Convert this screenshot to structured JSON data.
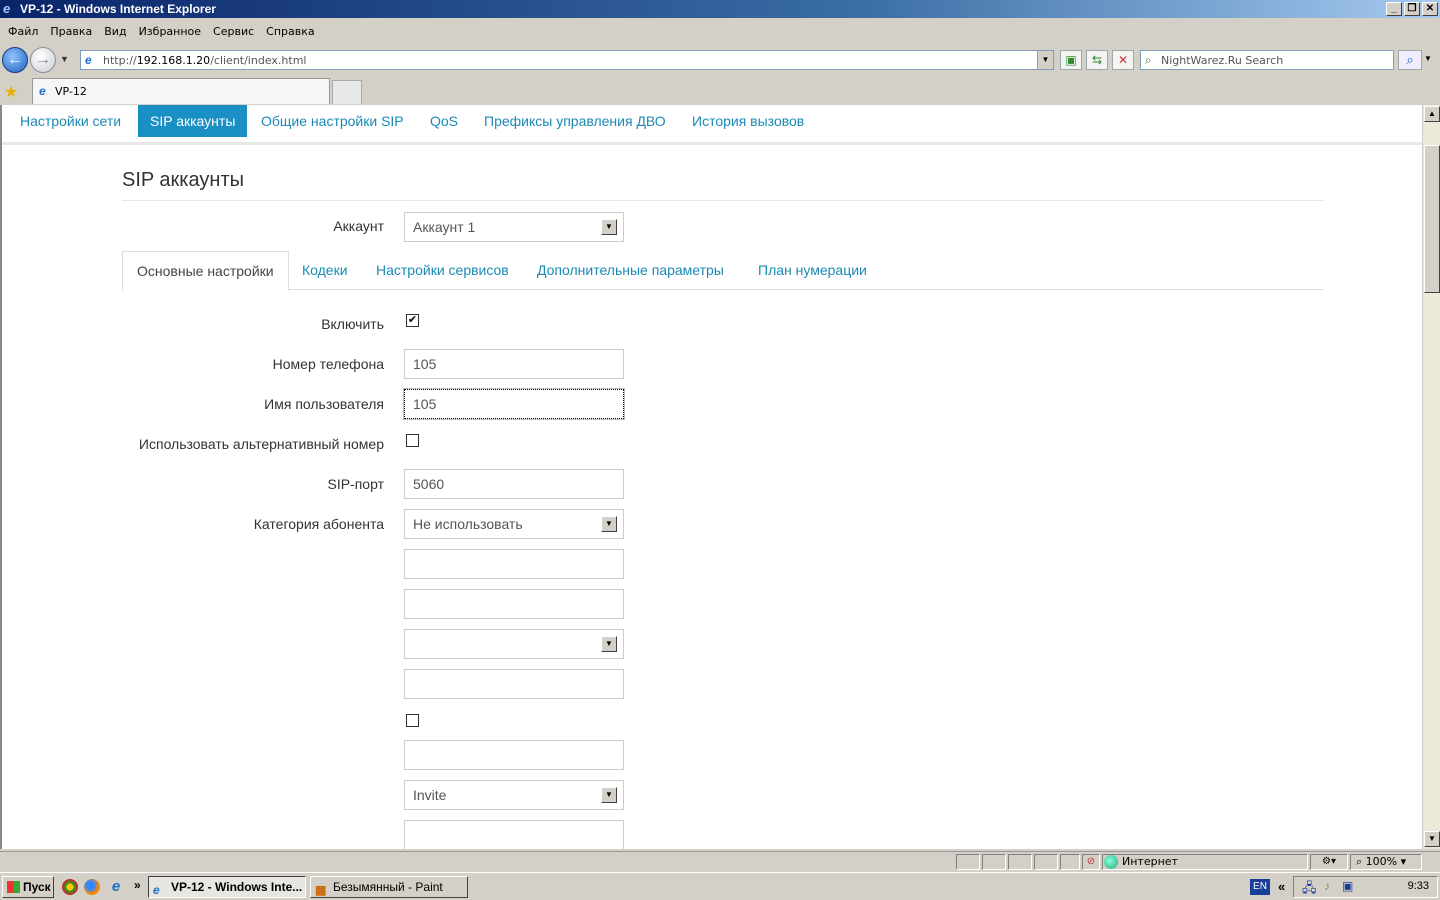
{
  "window": {
    "title": "VP-12 - Windows Internet Explorer"
  },
  "menubar": [
    "Файл",
    "Правка",
    "Вид",
    "Избранное",
    "Сервис",
    "Справка"
  ],
  "address": {
    "url_prefix": "http://",
    "url_host": "192.168.1.20",
    "url_path": "/client/index.html"
  },
  "search": {
    "placeholder": "NightWarez.Ru Search"
  },
  "browser_tab": {
    "title": "VP-12"
  },
  "topnav": [
    "Настройки сети",
    "SIP аккаунты",
    "Общие настройки SIP",
    "QoS",
    "Префиксы управления ДВО",
    "История вызовов"
  ],
  "page": {
    "title": "SIP аккаунты"
  },
  "account": {
    "label": "Аккаунт",
    "value": "Аккаунт 1"
  },
  "subtabs": [
    "Основные настройки",
    "Кодеки",
    "Настройки сервисов",
    "Дополнительные параметры",
    "План нумерации"
  ],
  "form": {
    "enable_label": "Включить",
    "phone_label": "Номер телефона",
    "phone_value": "105",
    "user_label": "Имя пользователя",
    "user_value": "105",
    "alt_label": "Использовать альтернативный номер",
    "port_label": "SIP-порт",
    "port_value": "5060",
    "category_label": "Категория абонента",
    "category_value": "Не использовать",
    "invite_value": "Invite"
  },
  "statusbar": {
    "zone": "Интернет",
    "zoom": "100%"
  },
  "taskbar": {
    "start": "Пуск",
    "items": [
      "VP-12 - Windows Inte...",
      "Безымянный - Paint"
    ],
    "lang": "EN",
    "clock": "9:33"
  }
}
